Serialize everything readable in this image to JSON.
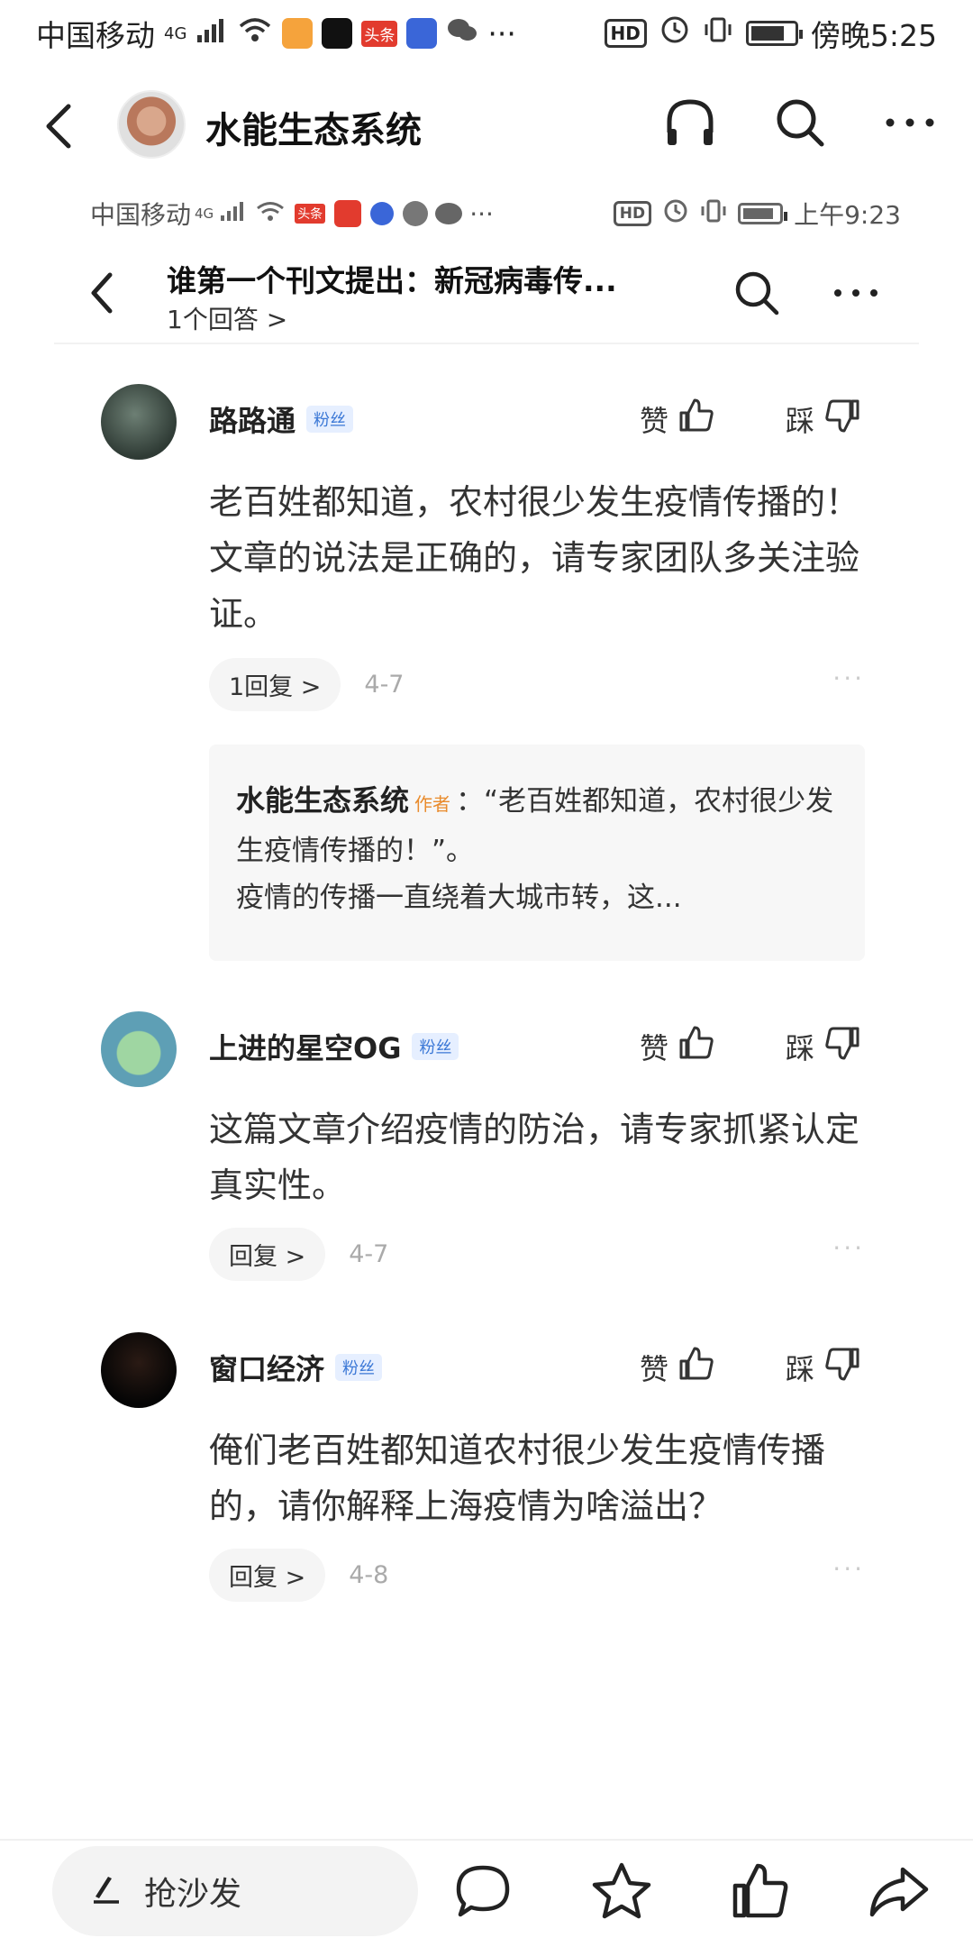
{
  "status_outer": {
    "carrier": "中国移动",
    "network": "4G",
    "app_badge": "头条",
    "more": "···",
    "time": "傍晚5:25"
  },
  "header": {
    "title": "水能生态系统"
  },
  "inner_status": {
    "carrier": "中国移动",
    "network": "4G",
    "app_badge": "头条",
    "more": "···",
    "time": "上午9:23"
  },
  "inner_header": {
    "title": "谁第一个刊文提出：新冠病毒传...",
    "subtitle": "1个回答 >"
  },
  "comments": [
    {
      "name": "路路通",
      "badge": "粉丝",
      "like_label": "赞",
      "dislike_label": "踩",
      "text": "老百姓都知道，农村很少发生疫情传播的！文章的说法是正确的，请专家团队多关注验证。",
      "reply_label": "1回复 >",
      "date": "4-7",
      "more": "···",
      "reply": {
        "author": "水能生态系统",
        "author_tag": "作者",
        "quote": "：“老百姓都知道，农村很少发生疫情传播的！”。",
        "text": "疫情的传播一直绕着大城市转，这..."
      }
    },
    {
      "name": "上进的星空OG",
      "badge": "粉丝",
      "like_label": "赞",
      "dislike_label": "踩",
      "text": "这篇文章介绍疫情的防治，请专家抓紧认定真实性。",
      "reply_label": "回复 >",
      "date": "4-7",
      "more": "···"
    },
    {
      "name": "窗口经济",
      "badge": "粉丝",
      "like_label": "赞",
      "dislike_label": "踩",
      "text": "俺们老百姓都知道农村很少发生疫情传播的，请你解释上海疫情为啥溢出？",
      "reply_label": "回复 >",
      "date": "4-8",
      "more": "···"
    }
  ],
  "bottom_bar": {
    "input_placeholder": "抢沙发"
  }
}
